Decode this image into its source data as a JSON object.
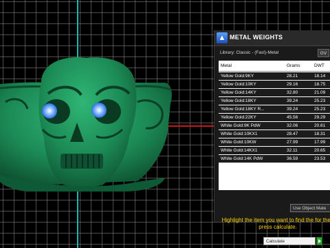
{
  "panel": {
    "logo_glyph": "▲",
    "title": "METAL WEIGHTS",
    "library_label": "Library: Classic - (Fast)-Metal",
    "gv_button": "GV",
    "columns": [
      "Metal",
      "Grams",
      "DWT"
    ],
    "rows": [
      {
        "metal": "Yellow Gold:9KY",
        "grams": "28.21",
        "dwt": "18.14"
      },
      {
        "metal": "Yellow Gold:10KY",
        "grams": "29.16",
        "dwt": "18.75"
      },
      {
        "metal": "Yellow Gold:14KY",
        "grams": "32.80",
        "dwt": "21.09"
      },
      {
        "metal": "Yellow Gold:18KY",
        "grams": "39.24",
        "dwt": "25.23"
      },
      {
        "metal": "Yellow Gold:18KY R...",
        "grams": "39.24",
        "dwt": "25.23"
      },
      {
        "metal": "Yellow Gold:22KY",
        "grams": "45.56",
        "dwt": "29.29"
      },
      {
        "metal": "White Gold:9K PdW",
        "grams": "32.06",
        "dwt": "20.61"
      },
      {
        "metal": "White Gold:10KX1",
        "grams": "28.47",
        "dwt": "18.31"
      },
      {
        "metal": "White Gold:10KW",
        "grams": "27.99",
        "dwt": "17.99"
      },
      {
        "metal": "White Gold:14KX1",
        "grams": "32.11",
        "dwt": "20.65"
      },
      {
        "metal": "White Gold:14K PdW",
        "grams": "36.59",
        "dwt": "23.53"
      }
    ],
    "use_object_button": "Use Object Mate",
    "instruction": "Highlight the item you want to find the for then press calculate.",
    "calculate_select": "Calculate"
  },
  "colors": {
    "model": "#1c8a55",
    "eyes": "#5aa8ff",
    "instruction_text": "#ffd200",
    "axis_vertical": "#1fb8b8",
    "axis_horizontal": "#c81818"
  }
}
